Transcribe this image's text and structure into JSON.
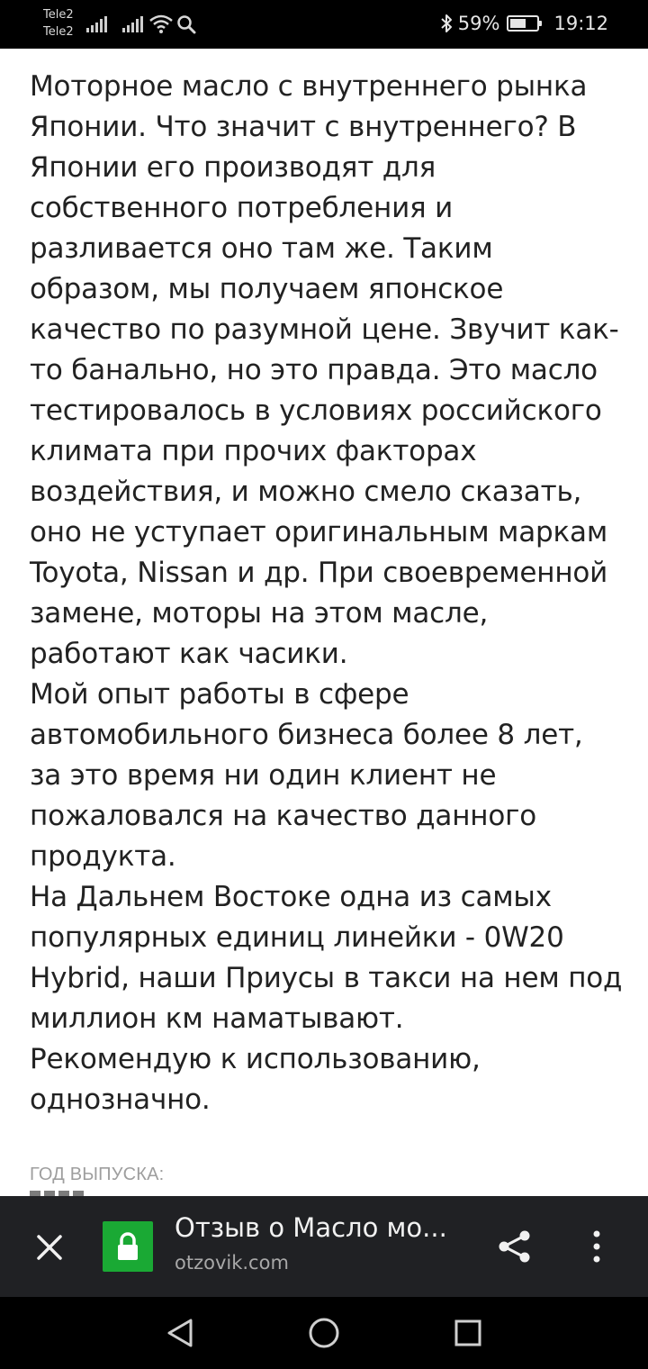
{
  "status_bar": {
    "carrier_1": "Tele2",
    "carrier_2": "Tele2",
    "battery_percent": "59%",
    "battery_level": 0.59,
    "time": "19:12",
    "icons": [
      "signal-icon",
      "signal-icon",
      "wifi-icon",
      "search-icon",
      "bluetooth-icon",
      "battery-icon"
    ]
  },
  "article": {
    "paragraph_1": "Моторное масло с внутреннего рынка\nЯпонии. Что значит с внутреннего? В\nЯпонии его производят для\nсобственного потребления и\nразливается оно там же. Таким\nобразом, мы получаем японское\nкачество по разумной цене. Звучит как-\nто банально, но это правда. Это масло\nтестировалось в условиях российского\nклимата при прочих факторах\nвоздействия, и можно смело сказать,\nоно не уступает оригинальным маркам\nToyota, Nissan и др. При своевременной\nзамене, моторы на этом масле,\nработают как часики.",
    "paragraph_2": "Мой опыт работы в сфере\nавтомобильного бизнеса более 8 лет,\nза это время ни один клиент не\nпожаловался на качество данного\nпродукта.",
    "paragraph_3": "На Дальнем Востоке одна из самых\nпопулярных единиц линейки - 0W20\nHybrid, наши Приусы в такси на нем под\nмиллион км наматывают.",
    "paragraph_4": "Рекомендую к использованию,\nоднозначно.",
    "year_label": "ГОД ВЫПУСКА:"
  },
  "browser_bar": {
    "title": "Отзыв о Масло мо...",
    "domain": "otzovik.com",
    "lock_color": "#1aa934",
    "background": "#202124"
  },
  "nav_bar": {
    "icons": [
      "back-icon",
      "home-icon",
      "recent-apps-icon"
    ]
  }
}
